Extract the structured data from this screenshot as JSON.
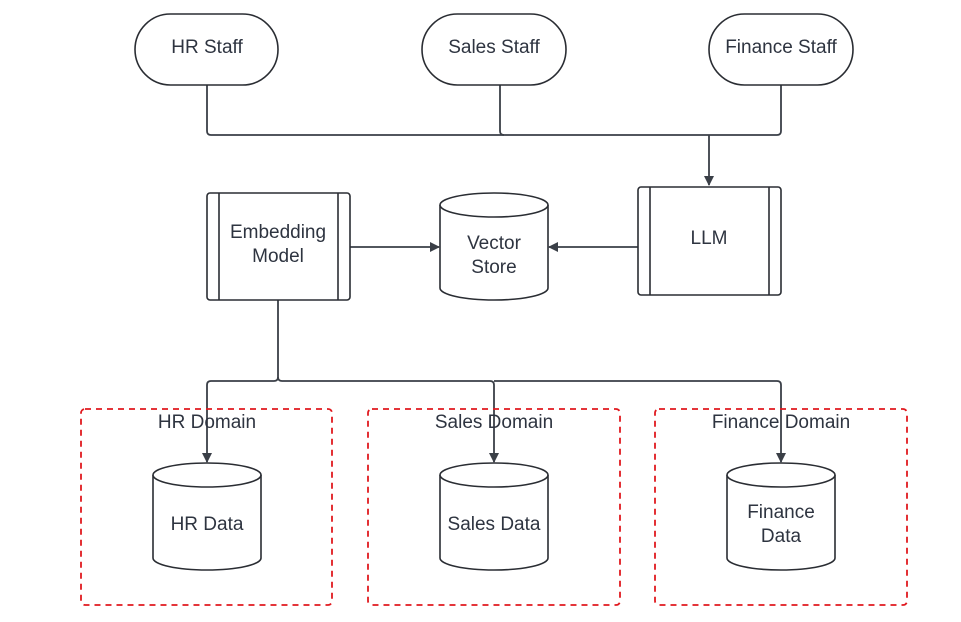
{
  "staff": {
    "hr": "HR Staff",
    "sales": "Sales Staff",
    "finance": "Finance Staff"
  },
  "processing": {
    "embedding_line1": "Embedding",
    "embedding_line2": "Model",
    "vector_line1": "Vector",
    "vector_line2": "Store",
    "llm": "LLM"
  },
  "domains": {
    "hr_label": "HR Domain",
    "sales_label": "Sales Domain",
    "finance_label": "Finance Domain",
    "hr_data": "HR Data",
    "sales_data": "Sales Data",
    "finance_data_line1": "Finance",
    "finance_data_line2": "Data"
  },
  "colors": {
    "domain_border": "#e0191f",
    "stroke": "#2a2d33"
  }
}
